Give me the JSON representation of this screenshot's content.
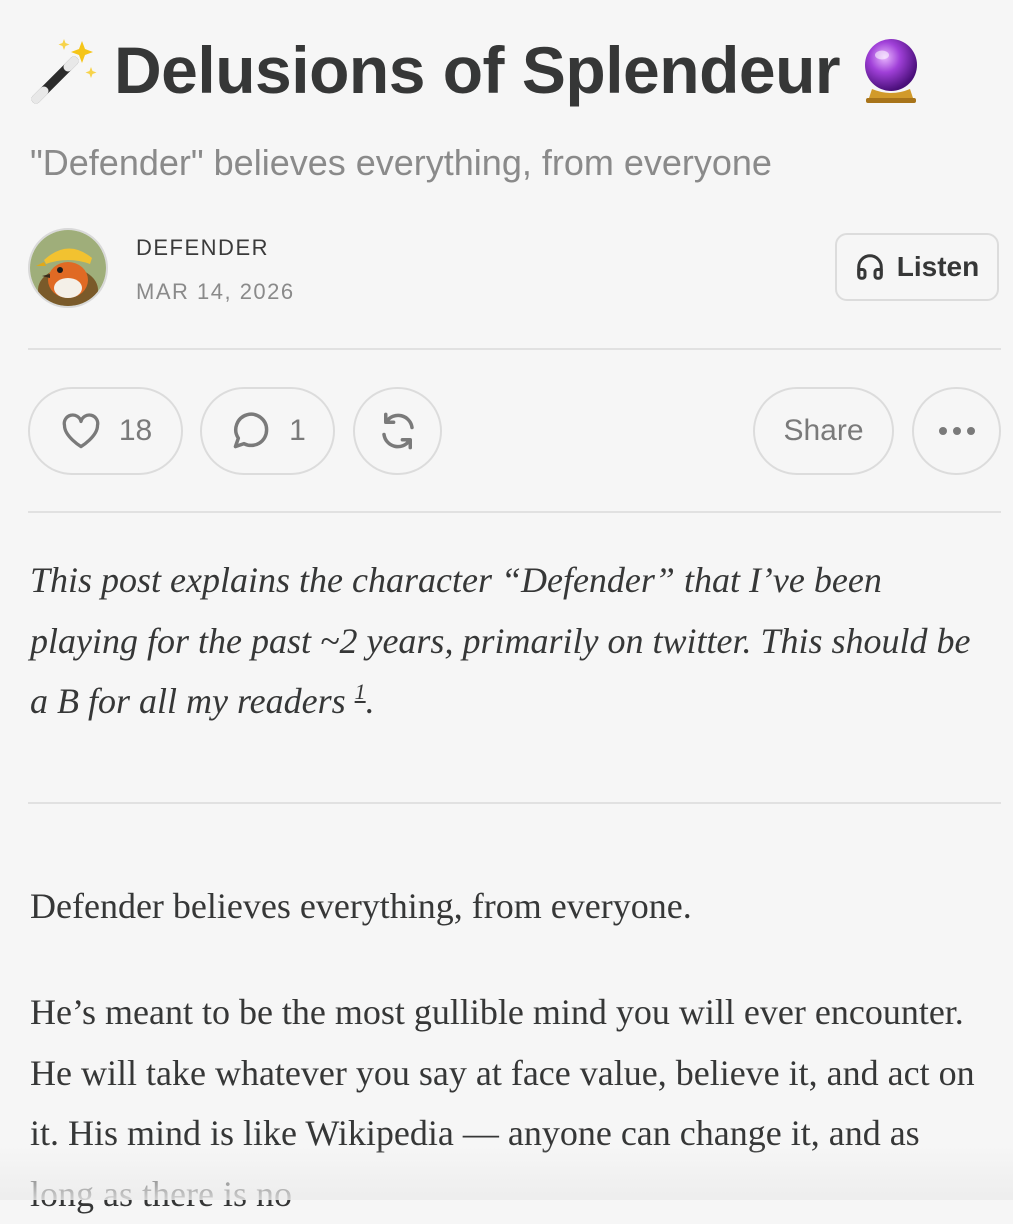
{
  "post": {
    "title": "Delusions of Splendeur",
    "title_emoji_left": "magic-wand-emoji",
    "title_emoji_right": "crystal-ball-emoji",
    "subtitle": "\"Defender\" believes everything, from everyone",
    "author": "DEFENDER",
    "date": "MAR 14, 2026",
    "listen_label": "Listen"
  },
  "actions": {
    "likes": "18",
    "comments": "1",
    "share_label": "Share"
  },
  "intro": {
    "text": "This post explains the character “Defender” that I’ve been playing for the past ~2 years, primarily on twitter. This should be a B for all my readers ",
    "footnote": "1",
    "end": "."
  },
  "body": {
    "p1": "Defender believes everything, from everyone.",
    "p2": "He’s meant to be the most gullible mind you will ever encounter. He will take whatever you say at face value, believe it, and act on it. His mind is like Wikipedia — anyone can change it, and as long as there is no"
  },
  "colors": {
    "background": "#f6f6f6",
    "text": "#363737",
    "muted": "#8a8a8a",
    "border": "#dcdcdc"
  },
  "icons": [
    "magic-wand-icon",
    "crystal-ball-icon",
    "headphones-icon",
    "heart-icon",
    "comment-icon",
    "restack-icon",
    "more-icon"
  ]
}
